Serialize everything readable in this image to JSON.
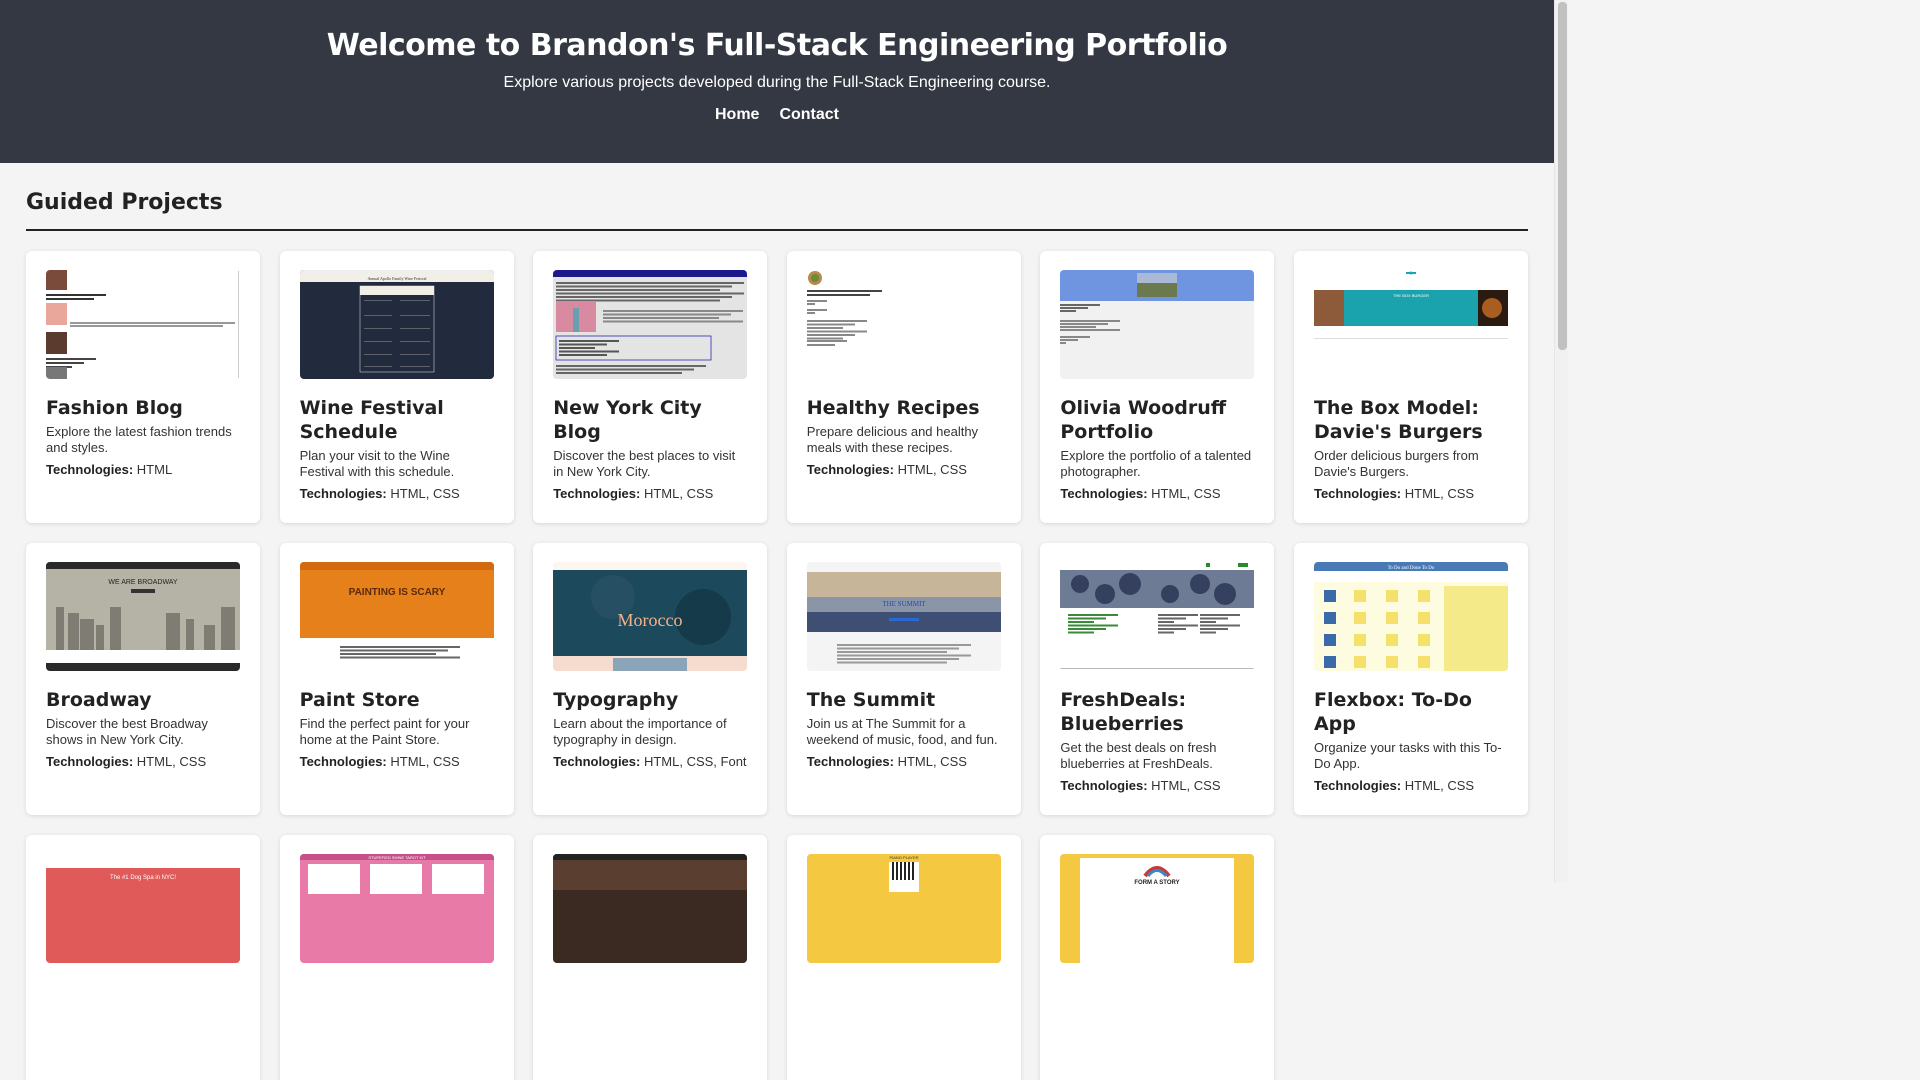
{
  "header": {
    "title": "Welcome to Brandon's Full-Stack Engineering Portfolio",
    "subtitle": "Explore various projects developed during the Full-Stack Engineering course.",
    "nav": [
      {
        "label": "Home"
      },
      {
        "label": "Contact"
      }
    ]
  },
  "section": {
    "title": "Guided Projects"
  },
  "tech_label": "Technologies:",
  "projects": [
    {
      "title": "Fashion Blog",
      "description": "Explore the latest fashion trends and styles.",
      "technologies": "HTML",
      "thumb": "fashion"
    },
    {
      "title": "Wine Festival Schedule",
      "description": "Plan your visit to the Wine Festival with this schedule.",
      "technologies": "HTML, CSS",
      "thumb": "wine"
    },
    {
      "title": "New York City Blog",
      "description": "Discover the best places to visit in New York City.",
      "technologies": "HTML, CSS",
      "thumb": "nyc"
    },
    {
      "title": "Healthy Recipes",
      "description": "Prepare delicious and healthy meals with these recipes.",
      "technologies": "HTML, CSS",
      "thumb": "recipes"
    },
    {
      "title": "Olivia Woodruff Portfolio",
      "description": "Explore the portfolio of a talented photographer.",
      "technologies": "HTML, CSS",
      "thumb": "olivia"
    },
    {
      "title": "The Box Model: Davie's Burgers",
      "description": "Order delicious burgers from Davie's Burgers.",
      "technologies": "HTML, CSS",
      "thumb": "box"
    },
    {
      "title": "Broadway",
      "description": "Discover the best Broadway shows in New York City.",
      "technologies": "HTML, CSS",
      "thumb": "broadway"
    },
    {
      "title": "Paint Store",
      "description": "Find the perfect paint for your home at the Paint Store.",
      "technologies": "HTML, CSS",
      "thumb": "paint"
    },
    {
      "title": "Typography",
      "description": "Learn about the importance of typography in design.",
      "technologies": "HTML, CSS, Font",
      "thumb": "typo"
    },
    {
      "title": "The Summit",
      "description": "Join us at The Summit for a weekend of music, food, and fun.",
      "technologies": "HTML, CSS",
      "thumb": "summit"
    },
    {
      "title": "FreshDeals: Blueberries",
      "description": "Get the best deals on fresh blueberries at FreshDeals.",
      "technologies": "HTML, CSS",
      "thumb": "fresh"
    },
    {
      "title": "Flexbox: To-Do App",
      "description": "Organize your tasks with this To-Do App.",
      "technologies": "HTML, CSS",
      "thumb": "flex"
    },
    {
      "title": "",
      "description": "",
      "technologies": "",
      "thumb": "dog"
    },
    {
      "title": "",
      "description": "",
      "technologies": "",
      "thumb": "tarot"
    },
    {
      "title": "",
      "description": "",
      "technologies": "",
      "thumb": "coffee"
    },
    {
      "title": "",
      "description": "",
      "technologies": "",
      "thumb": "piano"
    },
    {
      "title": "",
      "description": "",
      "technologies": "",
      "thumb": "story"
    }
  ],
  "thumb_text": {
    "wine": "Annual Apollo Family Wine Festival",
    "box": "THE BOX BURGER",
    "broadway": "WE ARE BROADWAY",
    "paint": "PAINTING IS SCARY",
    "typo": "Morocco",
    "summit": "THE SUMMIT",
    "fresh": "FreshDeals",
    "flex": "To Do and Done To Do",
    "dog": "The #1 Dog Spa in NYC!",
    "tarot": "STUPEFIED SHINE TAROT KIT",
    "piano": "PIANO PLAYER",
    "story": "FORM A STORY"
  },
  "colors": {
    "header_bg": "#333842",
    "page_bg": "#f4f4f4",
    "card_bg": "#ffffff"
  }
}
